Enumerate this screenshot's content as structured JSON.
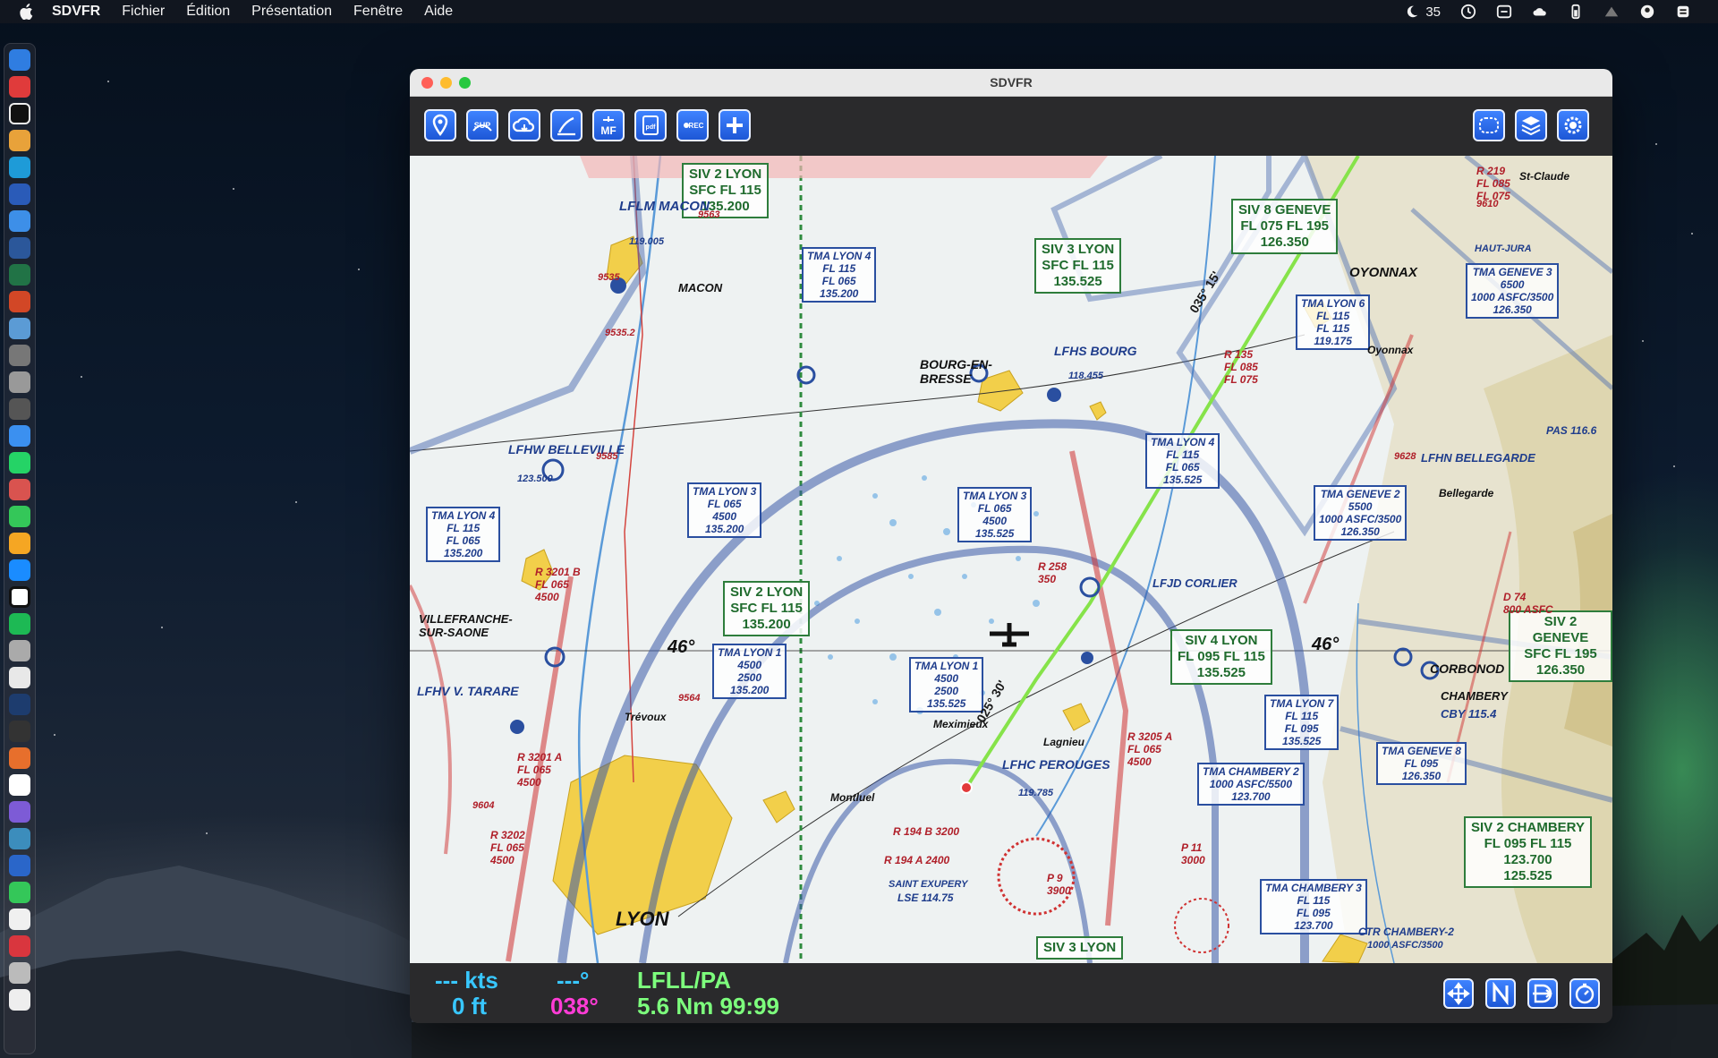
{
  "menubar": {
    "app_name": "SDVFR",
    "items": [
      "Fichier",
      "Édition",
      "Présentation",
      "Fenêtre",
      "Aide"
    ],
    "status_temp": "35"
  },
  "window": {
    "title": "SDVFR"
  },
  "toolbar": {
    "left_buttons": [
      {
        "icon": "map-pin-icon"
      },
      {
        "icon": "sup-icon",
        "text": "SUP"
      },
      {
        "icon": "weather-cloud-icon"
      },
      {
        "icon": "profile-chart-icon"
      },
      {
        "icon": "vac-chart-icon",
        "text": "MF"
      },
      {
        "icon": "pdf-document-icon",
        "text": "pdf"
      },
      {
        "icon": "record-icon",
        "text": "REC"
      },
      {
        "icon": "plus-icon"
      }
    ],
    "right_buttons": [
      {
        "icon": "route-icon"
      },
      {
        "icon": "layers-icon"
      },
      {
        "icon": "settings-gear-icon"
      }
    ]
  },
  "map": {
    "airspace_labels": [
      {
        "name": "SIV 2 LYON",
        "lines": [
          "SIV 2 LYON",
          "SFC  FL 115",
          "135.200"
        ]
      },
      {
        "name": "SIV 3 LYON",
        "lines": [
          "SIV 3 LYON",
          "SFC  FL 115",
          "135.525"
        ]
      },
      {
        "name": "SIV 8 GENEVE",
        "lines": [
          "SIV 8 GENEVE",
          "FL 075  FL 195",
          "126.350"
        ]
      },
      {
        "name": "SIV 2 LYON center",
        "lines": [
          "SIV 2 LYON",
          "SFC  FL 115",
          "135.200"
        ]
      },
      {
        "name": "SIV 4 LYON",
        "lines": [
          "SIV 4 LYON",
          "FL 095  FL 115",
          "135.525"
        ]
      },
      {
        "name": "SIV 2 GENEVE",
        "lines": [
          "SIV 2 GENEVE",
          "SFC  FL 195",
          "126.350"
        ]
      },
      {
        "name": "SIV 2 CHAMBERY",
        "lines": [
          "SIV 2 CHAMBERY",
          "FL 095  FL 115",
          "123.700",
          "125.525"
        ]
      },
      {
        "name": "SIV 3 LYON bottom",
        "lines": [
          "SIV 3 LYON"
        ]
      }
    ],
    "tma_labels": [
      {
        "lines": [
          "TMA LYON 4",
          "FL 115",
          "FL 065",
          "135.200"
        ]
      },
      {
        "lines": [
          "TMA LYON 3",
          "FL 065",
          "4500",
          "135.200"
        ]
      },
      {
        "lines": [
          "TMA LYON 3",
          "FL 065",
          "4500",
          "135.525"
        ]
      },
      {
        "lines": [
          "TMA LYON 4",
          "FL 115",
          "FL 065",
          "135.525"
        ]
      },
      {
        "lines": [
          "TMA LYON 4",
          "FL 115",
          "FL 065",
          "135.200"
        ]
      },
      {
        "lines": [
          "TMA LYON 1",
          "4500",
          "2500",
          "135.200"
        ]
      },
      {
        "lines": [
          "TMA LYON 1",
          "4500",
          "2500",
          "135.525"
        ]
      },
      {
        "lines": [
          "TMA GENEVE 3",
          "6500",
          "1000 ASFC/3500",
          "126.350"
        ]
      },
      {
        "lines": [
          "TMA GENEVE 2",
          "5500",
          "1000 ASFC/3500",
          "126.350"
        ]
      },
      {
        "lines": [
          "TMA LYON 6",
          "FL 115",
          "FL 115",
          "119.175"
        ]
      },
      {
        "lines": [
          "TMA LYON 7",
          "FL 115",
          "FL 095",
          "135.525"
        ]
      },
      {
        "lines": [
          "TMA CHAMBERY 2",
          "1000 ASFC/5500",
          "123.700"
        ]
      },
      {
        "lines": [
          "TMA CHAMBERY 3",
          "FL 115",
          "FL 095",
          "123.700"
        ]
      },
      {
        "lines": [
          "TMA GENEVE 8",
          "FL 095",
          "126.350"
        ]
      }
    ],
    "place_labels": [
      "LFLM MACON",
      "119.005",
      "MACON",
      "BOURG-EN-BRESSE",
      "LFHS BOURG",
      "118.455",
      "LFHW BELLEVILLE",
      "123.500",
      "VILLEFRANCHE-SUR-SAONE",
      "LFHV V. TARARE",
      "LFHC PEROUGES",
      "119.785",
      "LYON",
      "LFJD CORLIER",
      "OYONNAX",
      "LFHN BELLEGARDE",
      "CORBONOD",
      "CHAMBERY",
      "LSE 114.75",
      "SAINT EXUPERY",
      "CBY 115.4",
      "PAS 116.6",
      "Meximieux",
      "Montluel",
      "Trévoux",
      "Lagnieu",
      "Oyonnax",
      "St-Claude",
      "Bellegarde",
      "46°",
      "46°",
      "HAUT-JURA",
      "CTR CHAMBERY-2",
      "1000 ASFC/3500"
    ],
    "restricted_labels": [
      "R 3201 B",
      "FL 065",
      "4500",
      "R 3201 A",
      "FL 065",
      "4500",
      "R 3202",
      "FL 065",
      "4500",
      "R 258",
      "350",
      "R 135",
      "FL 085",
      "FL 075",
      "R 219",
      "FL 085",
      "FL 075",
      "R 3205 A",
      "FL 065",
      "4500",
      "P 11",
      "3000",
      "P 9",
      "3900",
      "R 194 B",
      "3200",
      "R 194 A",
      "2400",
      "D 74",
      "800 ASFC",
      "9535.2",
      "9564",
      "9604",
      "9585",
      "9535",
      "9563",
      "9628",
      "9610"
    ],
    "route": {
      "label_upper": "035° 15'",
      "label_lower": "025° 30'"
    }
  },
  "statusbar": {
    "speed": "--- kts",
    "altitude": "0 ft",
    "heading": "---°",
    "track": "038°",
    "waypoint": "LFLL/PA",
    "distance_time": "5.6 Nm 99:99",
    "buttons": [
      {
        "icon": "center-position-icon"
      },
      {
        "icon": "north-up-icon"
      },
      {
        "icon": "track-up-icon"
      },
      {
        "icon": "timer-icon"
      }
    ]
  }
}
